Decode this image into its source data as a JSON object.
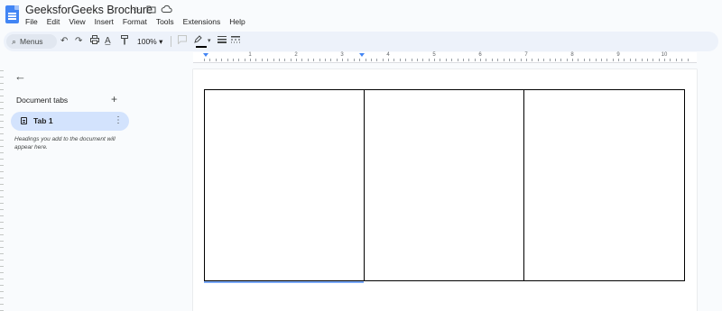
{
  "document": {
    "title": "GeeksforGeeks Brochure"
  },
  "menu": [
    "File",
    "Edit",
    "View",
    "Insert",
    "Format",
    "Tools",
    "Extensions",
    "Help"
  ],
  "toolbar": {
    "search_label": "Menus",
    "zoom": "100%"
  },
  "ruler": {
    "numbers": [
      "1",
      "2",
      "3",
      "4",
      "5",
      "6",
      "7",
      "8",
      "9",
      "10"
    ]
  },
  "sidebar": {
    "heading": "Document tabs",
    "tab_label": "Tab 1",
    "hint": "Headings you add to the document will appear here."
  },
  "layout_table": {
    "rows": 1,
    "columns": 3
  },
  "icons": {
    "doc": "docs-logo-icon",
    "star": "star-icon",
    "folder": "move-folder-icon",
    "cloud": "cloud-saved-icon",
    "back": "back-arrow-icon"
  }
}
